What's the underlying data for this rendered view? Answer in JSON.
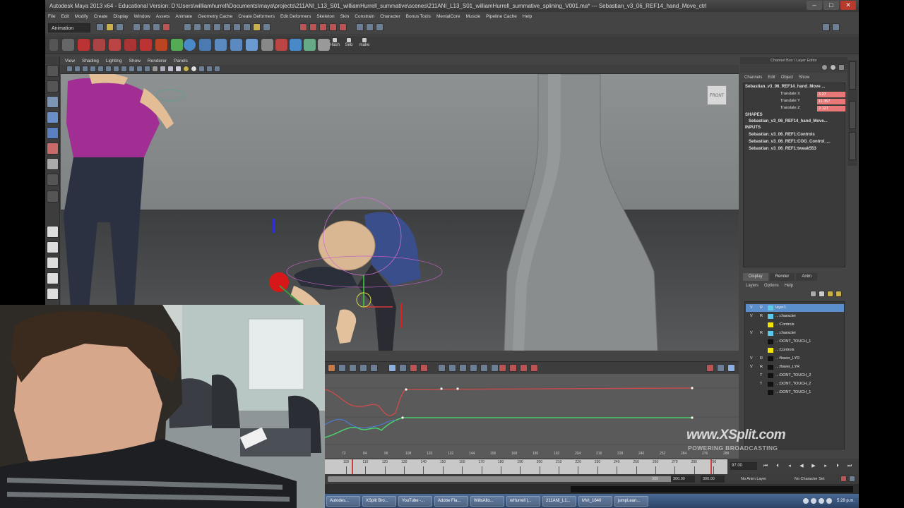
{
  "window": {
    "title": "Autodesk Maya 2013 x64 - Educational Version: D:\\Users\\williamhurrell\\Documents\\maya\\projects\\211ANI_L13_S01_williamHurrell_summative\\scenes\\211ANI_L13_S01_williamHurrell_summative_splining_V001.ma* --- Sebastian_v3_06_REF14_hand_Move_ctrl",
    "controls": [
      "–",
      "□",
      "✕"
    ]
  },
  "menubar": [
    "File",
    "Edit",
    "Modify",
    "Create",
    "Display",
    "Window",
    "Assets",
    "Animate",
    "Geometry Cache",
    "Create Deformers",
    "Edit Deformers",
    "Skeleton",
    "Skin",
    "Constrain",
    "Character",
    "Bonus Tools",
    "MentalCore",
    "Muscle",
    "Pipeline Cache",
    "Help"
  ],
  "statusline": {
    "mode": "Animation"
  },
  "shelf": {
    "labels": [
      "Hash",
      "Seb",
      "make"
    ]
  },
  "viewport": {
    "menu": [
      "View",
      "Shading",
      "Lighting",
      "Show",
      "Renderer",
      "Panels"
    ],
    "viewcube_label": "FRONT"
  },
  "channel_box": {
    "title": "Channel Box / Layer Editor",
    "menu": [
      "Channels",
      "Edit",
      "Object",
      "Show"
    ],
    "node": "Sebastian_v3_06_REF14_hand_Move ...",
    "attributes": [
      {
        "name": "Translate X",
        "value": "3.27"
      },
      {
        "name": "Translate Y",
        "value": "11.357"
      },
      {
        "name": "Translate Z",
        "value": "2.127"
      }
    ],
    "shapes_header": "SHAPES",
    "shapes": [
      "Sebastian_v3_06_REF14_hand_Move..."
    ],
    "inputs_header": "INPUTS",
    "inputs": [
      "Sebastian_v3_06_REF1:Controls",
      "Sebastian_v3_06_REF1:COG_Control_...",
      "Sebastian_v3_06_REF1:tweak553"
    ]
  },
  "layer_editor": {
    "tabs": [
      "Display",
      "Render",
      "Anim"
    ],
    "menu": [
      "Layers",
      "Options",
      "Help"
    ],
    "layers": [
      {
        "v": "V",
        "r": "R",
        "color": "#5bc8e8",
        "name": "layer1",
        "selected": true
      },
      {
        "v": "V",
        "r": "R",
        "color": "#5bc8e8",
        "name": "...:character",
        "selected": false
      },
      {
        "v": "",
        "r": "",
        "color": "#f2e600",
        "name": "...:Controls",
        "selected": false
      },
      {
        "v": "V",
        "r": "R",
        "color": "#5bc8e8",
        "name": "...:character",
        "selected": false
      },
      {
        "v": "",
        "r": "",
        "color": "#111111",
        "name": "...:DONT_TOUCH_1",
        "selected": false
      },
      {
        "v": "",
        "r": "",
        "color": "#f2e600",
        "name": "...:Controls",
        "selected": false
      },
      {
        "v": "V",
        "r": "R",
        "color": "#111111",
        "name": "...:flower_LYR",
        "selected": false
      },
      {
        "v": "V",
        "r": "R",
        "color": "#111111",
        "name": "...:flower_LYR",
        "selected": false
      },
      {
        "v": "",
        "r": "T",
        "color": "#111111",
        "name": "...:DONT_TOUCH_2",
        "selected": false
      },
      {
        "v": "",
        "r": "T",
        "color": "#111111",
        "name": "...:DONT_TOUCH_2",
        "selected": false
      },
      {
        "v": "",
        "r": "",
        "color": "#111111",
        "name": "...:DONT_TOUCH_1",
        "selected": false
      }
    ]
  },
  "graph_editor": {
    "frame_ticks": [
      "72",
      "84",
      "96",
      "108",
      "120",
      "132",
      "144",
      "156",
      "168",
      "180",
      "192",
      "204",
      "216",
      "228",
      "240",
      "252",
      "264",
      "276",
      "288"
    ]
  },
  "time_slider": {
    "ticks": [
      "100",
      "110",
      "120",
      "130",
      "140",
      "150",
      "160",
      "170",
      "180",
      "190",
      "200",
      "210",
      "220",
      "230",
      "240",
      "250",
      "260",
      "270",
      "280",
      "290"
    ],
    "current_frame": "97.00"
  },
  "range": {
    "start": "300",
    "end": "300.00",
    "end2": "300.00",
    "anim_layer": "No Anim Layer",
    "character_set": "No Character Set"
  },
  "taskbar": {
    "tasks": [
      "Autodes...",
      "XSplit Bro...",
      "YouTube -...",
      "Adobe Fla...",
      "WillsAllo...",
      "wHurrell (...",
      "211ANI_L1...",
      "MVI_1640",
      "jumpLean..."
    ],
    "clock": "5:28 p.m."
  },
  "watermark": {
    "main": "www.XSplit.com",
    "sub": "POWERING BROADCASTING"
  }
}
